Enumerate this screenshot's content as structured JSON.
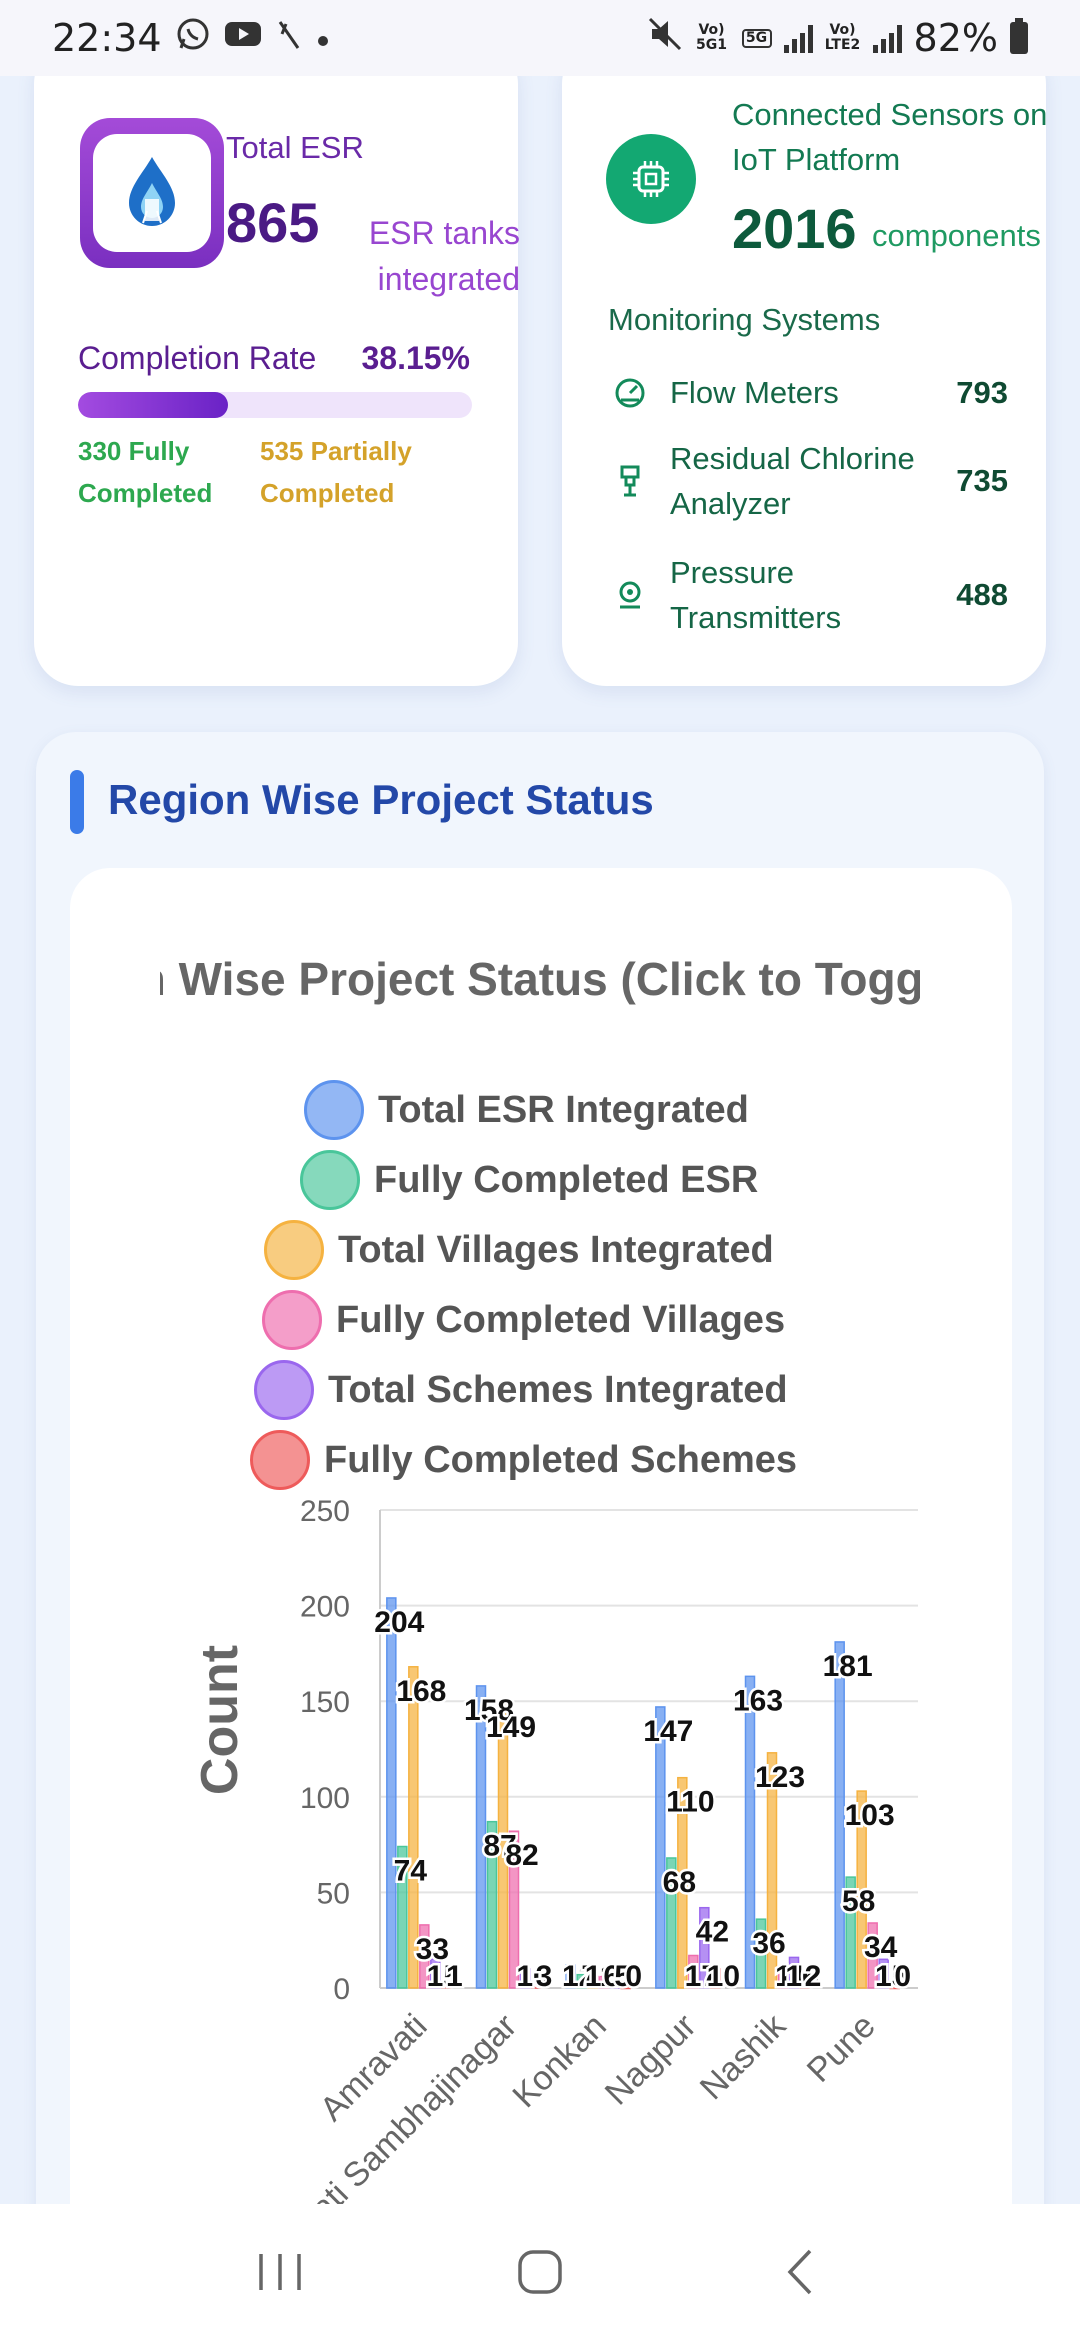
{
  "status_bar": {
    "time": "22:34",
    "left_icons": [
      "whatsapp-icon",
      "youtube-icon",
      "signal-app-icon",
      "dot-icon"
    ],
    "network1": "Vo) 5G1",
    "network_5g": "5G",
    "network2": "Vo) LTE2",
    "battery": "82%"
  },
  "esr_card": {
    "label": "Total ESR",
    "value": "865",
    "unit": "ESR tanks integrated",
    "completion_label": "Completion Rate",
    "completion_value": "38.15%",
    "completion_fraction": 0.3815,
    "fully_completed": "330 Fully Completed",
    "partially_completed": "535 Partially Completed"
  },
  "sensors_card": {
    "label": "Connected Sensors on IoT Platform",
    "value": "2016",
    "unit": "components",
    "monitoring_title": "Monitoring Systems",
    "items": [
      {
        "label": "Flow Meters",
        "value": "793",
        "icon": "gauge-icon"
      },
      {
        "label": "Residual Chlorine Analyzer",
        "value": "735",
        "icon": "analyzer-icon"
      },
      {
        "label": "Pressure Transmitters",
        "value": "488",
        "icon": "pressure-icon"
      }
    ]
  },
  "region_section": {
    "title": "Region Wise Project Status"
  },
  "chart_data": {
    "type": "bar",
    "title": "Region Wise Project Status (Click to Toggle)",
    "ylabel": "Count",
    "xlabel": "",
    "ylim": [
      0,
      250
    ],
    "yticks": [
      0,
      50,
      100,
      150,
      200,
      250
    ],
    "grid": true,
    "legend_position": "top",
    "categories": [
      "Amravati",
      "Chhatrapati Sambhajinagar",
      "Konkan",
      "Nagpur",
      "Nashik",
      "Pune"
    ],
    "series": [
      {
        "name": "Total ESR Integrated",
        "color": "#5d93ee",
        "values": [
          204,
          158,
          12,
          147,
          163,
          181
        ]
      },
      {
        "name": "Fully Completed ESR",
        "color": "#49c69a",
        "values": [
          74,
          87,
          7,
          68,
          36,
          58
        ]
      },
      {
        "name": "Total Villages Integrated",
        "color": "#f5b240",
        "values": [
          168,
          149,
          11,
          110,
          123,
          103
        ]
      },
      {
        "name": "Fully Completed Villages",
        "color": "#ee6eae",
        "values": [
          33,
          82,
          6,
          17,
          11,
          34
        ]
      },
      {
        "name": "Total Schemes Integrated",
        "color": "#9a67ee",
        "values": [
          15,
          10,
          5,
          42,
          16,
          15
        ]
      },
      {
        "name": "Fully Completed Schemes",
        "color": "#ee5b5b",
        "values": [
          1,
          3,
          0,
          10,
          2,
          0
        ]
      }
    ]
  }
}
